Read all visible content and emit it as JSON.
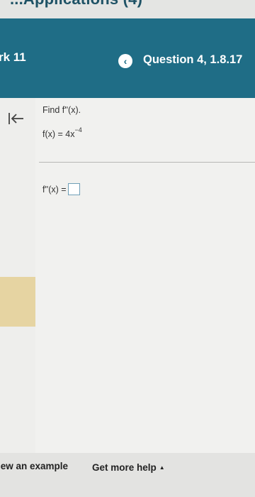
{
  "top_strip": {
    "cut_off_text": "...Applications (4)"
  },
  "header": {
    "homework_title": "rk 11",
    "question_title": "Question 4, 1.8.17"
  },
  "question": {
    "prompt": "Find f''(x).",
    "function_base": "f(x) = 4x",
    "function_exponent": "−4",
    "answer_label": "f''(x) ="
  },
  "footer": {
    "view_example": "iew an example",
    "get_help": "Get more help",
    "help_caret": "▲"
  },
  "icons": {
    "back": "chevron-left-icon",
    "collapse": "collapse-left-icon"
  },
  "colors": {
    "header_bg": "#1f6d86",
    "page_bg": "#f1f1ef",
    "accent_yellow": "#e6d4a2"
  }
}
